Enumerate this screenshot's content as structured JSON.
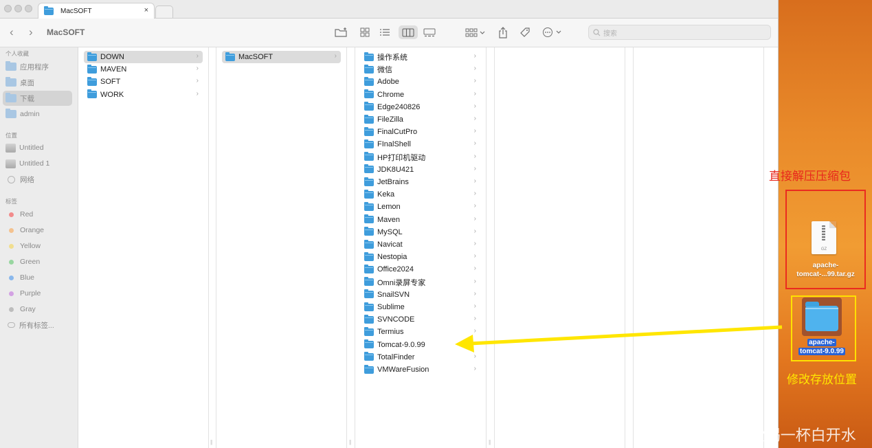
{
  "tab": {
    "title": "MacSOFT",
    "close": "×"
  },
  "toolbar": {
    "back": "‹",
    "forward": "›",
    "title": "MacSOFT",
    "search_placeholder": "搜索"
  },
  "sidebar": {
    "favorites_header": "个人收藏",
    "favorites": [
      "应用程序",
      "桌面",
      "下载",
      "admin"
    ],
    "locations_header": "位置",
    "locations": [
      "Untitled",
      "Untitled 1",
      "网络"
    ],
    "tags_header": "标签",
    "tags": [
      {
        "label": "Red",
        "color": "#f28b8b"
      },
      {
        "label": "Orange",
        "color": "#f4c28f"
      },
      {
        "label": "Yellow",
        "color": "#f1de8f"
      },
      {
        "label": "Green",
        "color": "#98d6a0"
      },
      {
        "label": "Blue",
        "color": "#8ab8ec"
      },
      {
        "label": "Purple",
        "color": "#d3a2e3"
      },
      {
        "label": "Gray",
        "color": "#bdbdbd"
      }
    ],
    "all_tags": "所有标签..."
  },
  "column1": [
    "DOWN",
    "MAVEN",
    "SOFT",
    "WORK"
  ],
  "column2": [
    "MacSOFT"
  ],
  "column3": [
    "操作系统",
    "微信",
    "Adobe",
    "Chrome",
    "Edge240826",
    "FileZilla",
    "FinalCutPro",
    "FInalShell",
    "HP打印机驱动",
    "JDK8U421",
    "JetBrains",
    "Keka",
    "Lemon",
    "Maven",
    "MySQL",
    "Navicat",
    "Nestopia",
    "Office2024",
    "Omni录屏专家",
    "SnailSVN",
    "Sublime",
    "SVNCODE",
    "Termius",
    "Tomcat-9.0.99",
    "TotalFinder",
    "VMWareFusion"
  ],
  "column3_no_chevron": "Tomcat-9.0.99",
  "desktop": {
    "annotation_top": "直接解压压缩包",
    "annotation_bottom": "修改存放位置",
    "gz_badge": "GZ",
    "gz_file_line1": "apache-",
    "gz_file_line2": "tomcat-...99.tar.gz",
    "folder_line1": "apache-",
    "folder_line2": "tomcat-9.0.99",
    "watermark": "CSDN @爱喝一杯白开水"
  },
  "colors": {
    "folder_blue": "#3f9ddc",
    "annotation_red": "#e8281d",
    "annotation_yellow": "#ffe600",
    "selection_blue": "#2862d6"
  }
}
